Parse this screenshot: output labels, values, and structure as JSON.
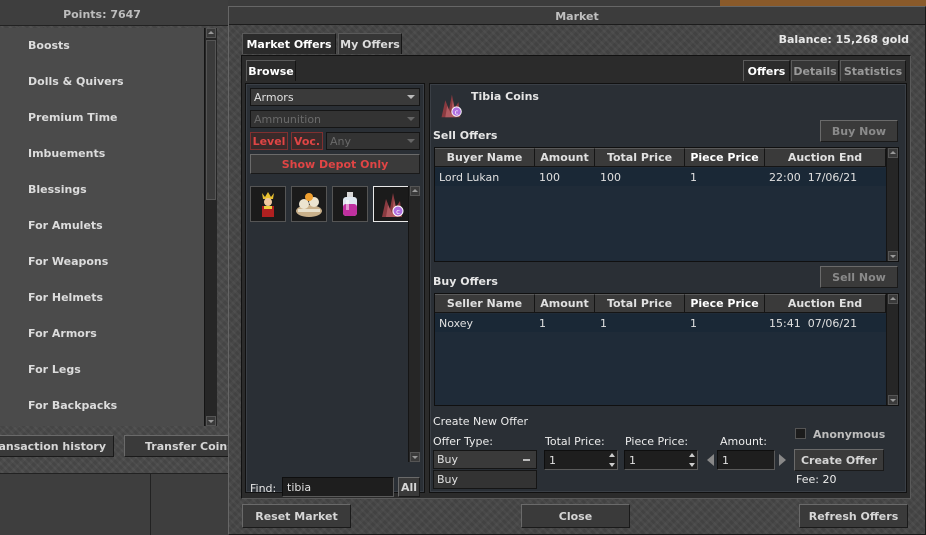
{
  "store": {
    "points_label": "Points: 7647",
    "categories": [
      "Boosts",
      "Dolls & Quivers",
      "Premium Time",
      "Imbuements",
      "Blessings",
      "For Amulets",
      "For Weapons",
      "For Helmets",
      "For Armors",
      "For Legs",
      "For Backpacks"
    ],
    "transaction_history_label": "Transaction history",
    "transfer_coins_label": "Transfer Coins"
  },
  "market": {
    "title": "Market",
    "balance": "Balance: 15,268 gold",
    "top_tabs": [
      "Market Offers",
      "My Offers"
    ],
    "browse_tab": "Browse",
    "detail_tabs": [
      "Offers",
      "Details",
      "Statistics"
    ],
    "category_select": "Armors",
    "subcategory_select": "Ammunition",
    "level_label": "Level",
    "voc_label": "Voc.",
    "voc_select": "Any",
    "show_depot_label": "Show Depot Only",
    "items": [
      {
        "icon": "king-figure-icon",
        "name": "king figure"
      },
      {
        "icon": "skull-pile-icon",
        "name": "bone pile"
      },
      {
        "icon": "potion-bottle-icon",
        "name": "potion"
      },
      {
        "icon": "tibia-coins-icon",
        "name": "Tibia Coins"
      }
    ],
    "find_label": "Find:",
    "find_value": "tibia",
    "all_button": "All",
    "selected_item_name": "Tibia Coins",
    "sell_offers": {
      "title": "Sell Offers",
      "action_button": "Buy Now",
      "columns": [
        "Buyer Name",
        "Amount",
        "Total Price",
        "Piece Price",
        "Auction End"
      ],
      "rows": [
        {
          "name": "Lord Lukan",
          "amount": "100",
          "total": "100",
          "piece": "1",
          "end": "22:00  17/06/21"
        }
      ]
    },
    "buy_offers": {
      "title": "Buy Offers",
      "action_button": "Sell Now",
      "columns": [
        "Seller Name",
        "Amount",
        "Total Price",
        "Piece Price",
        "Auction End"
      ],
      "rows": [
        {
          "name": "Noxey",
          "amount": "1",
          "total": "1",
          "piece": "1",
          "end": "15:41  07/06/21"
        }
      ]
    },
    "create_offer": {
      "title": "Create New Offer",
      "offer_type_label": "Offer Type:",
      "offer_type_value": "Buy",
      "offer_type_option": "Buy",
      "total_price_label": "Total Price:",
      "total_price_value": "1",
      "piece_price_label": "Piece Price:",
      "piece_price_value": "1",
      "amount_label": "Amount:",
      "amount_value": "1",
      "anonymous_label": "Anonymous",
      "create_button": "Create Offer",
      "fee": "Fee: 20"
    },
    "reset_button": "Reset Market",
    "close_button": "Close",
    "refresh_button": "Refresh Offers"
  }
}
